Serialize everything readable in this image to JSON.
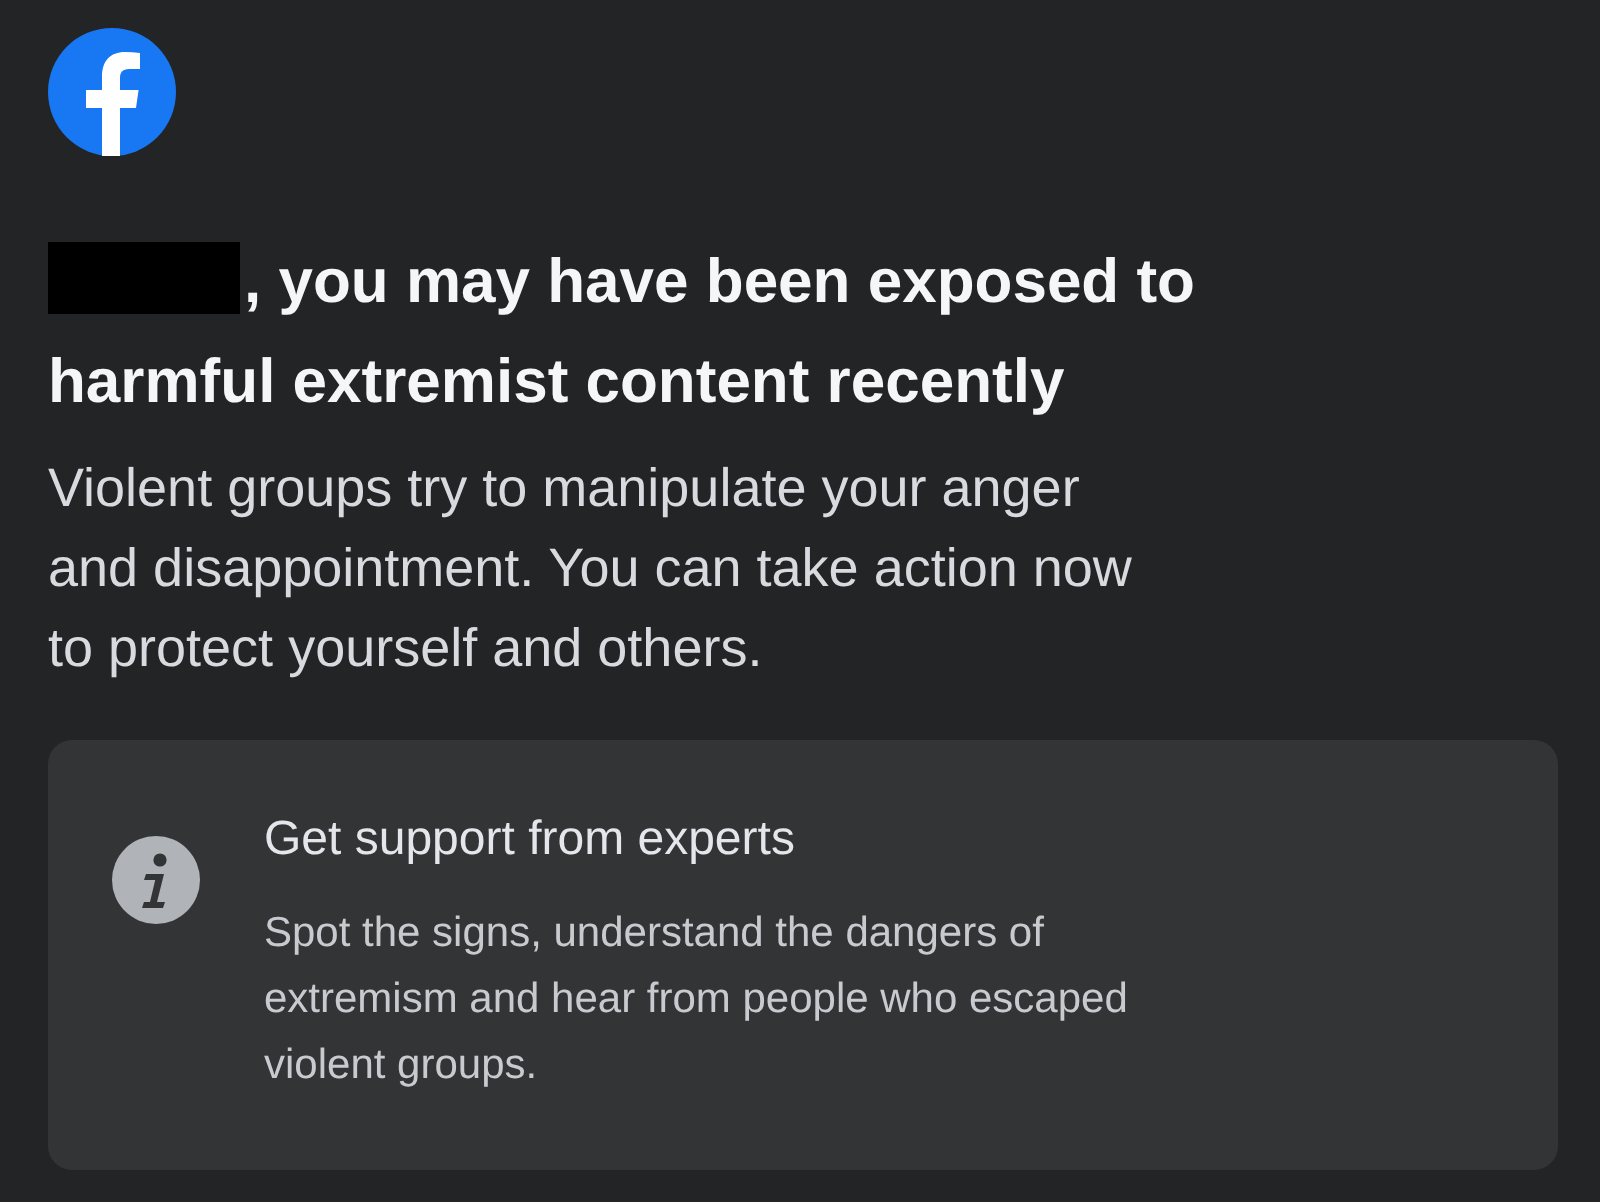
{
  "headline": {
    "redacted": true,
    "lines": [
      ", you may have been exposed to",
      "harmful extremist content recently"
    ]
  },
  "body": {
    "lines": [
      "Violent groups try to manipulate your anger",
      "and disappointment. You can take action now",
      "to protect yourself and others."
    ]
  },
  "card": {
    "title": "Get support from experts",
    "lines": [
      "Spot the signs, understand the dangers of",
      "extremism and hear from people who escaped",
      "violent groups."
    ]
  }
}
